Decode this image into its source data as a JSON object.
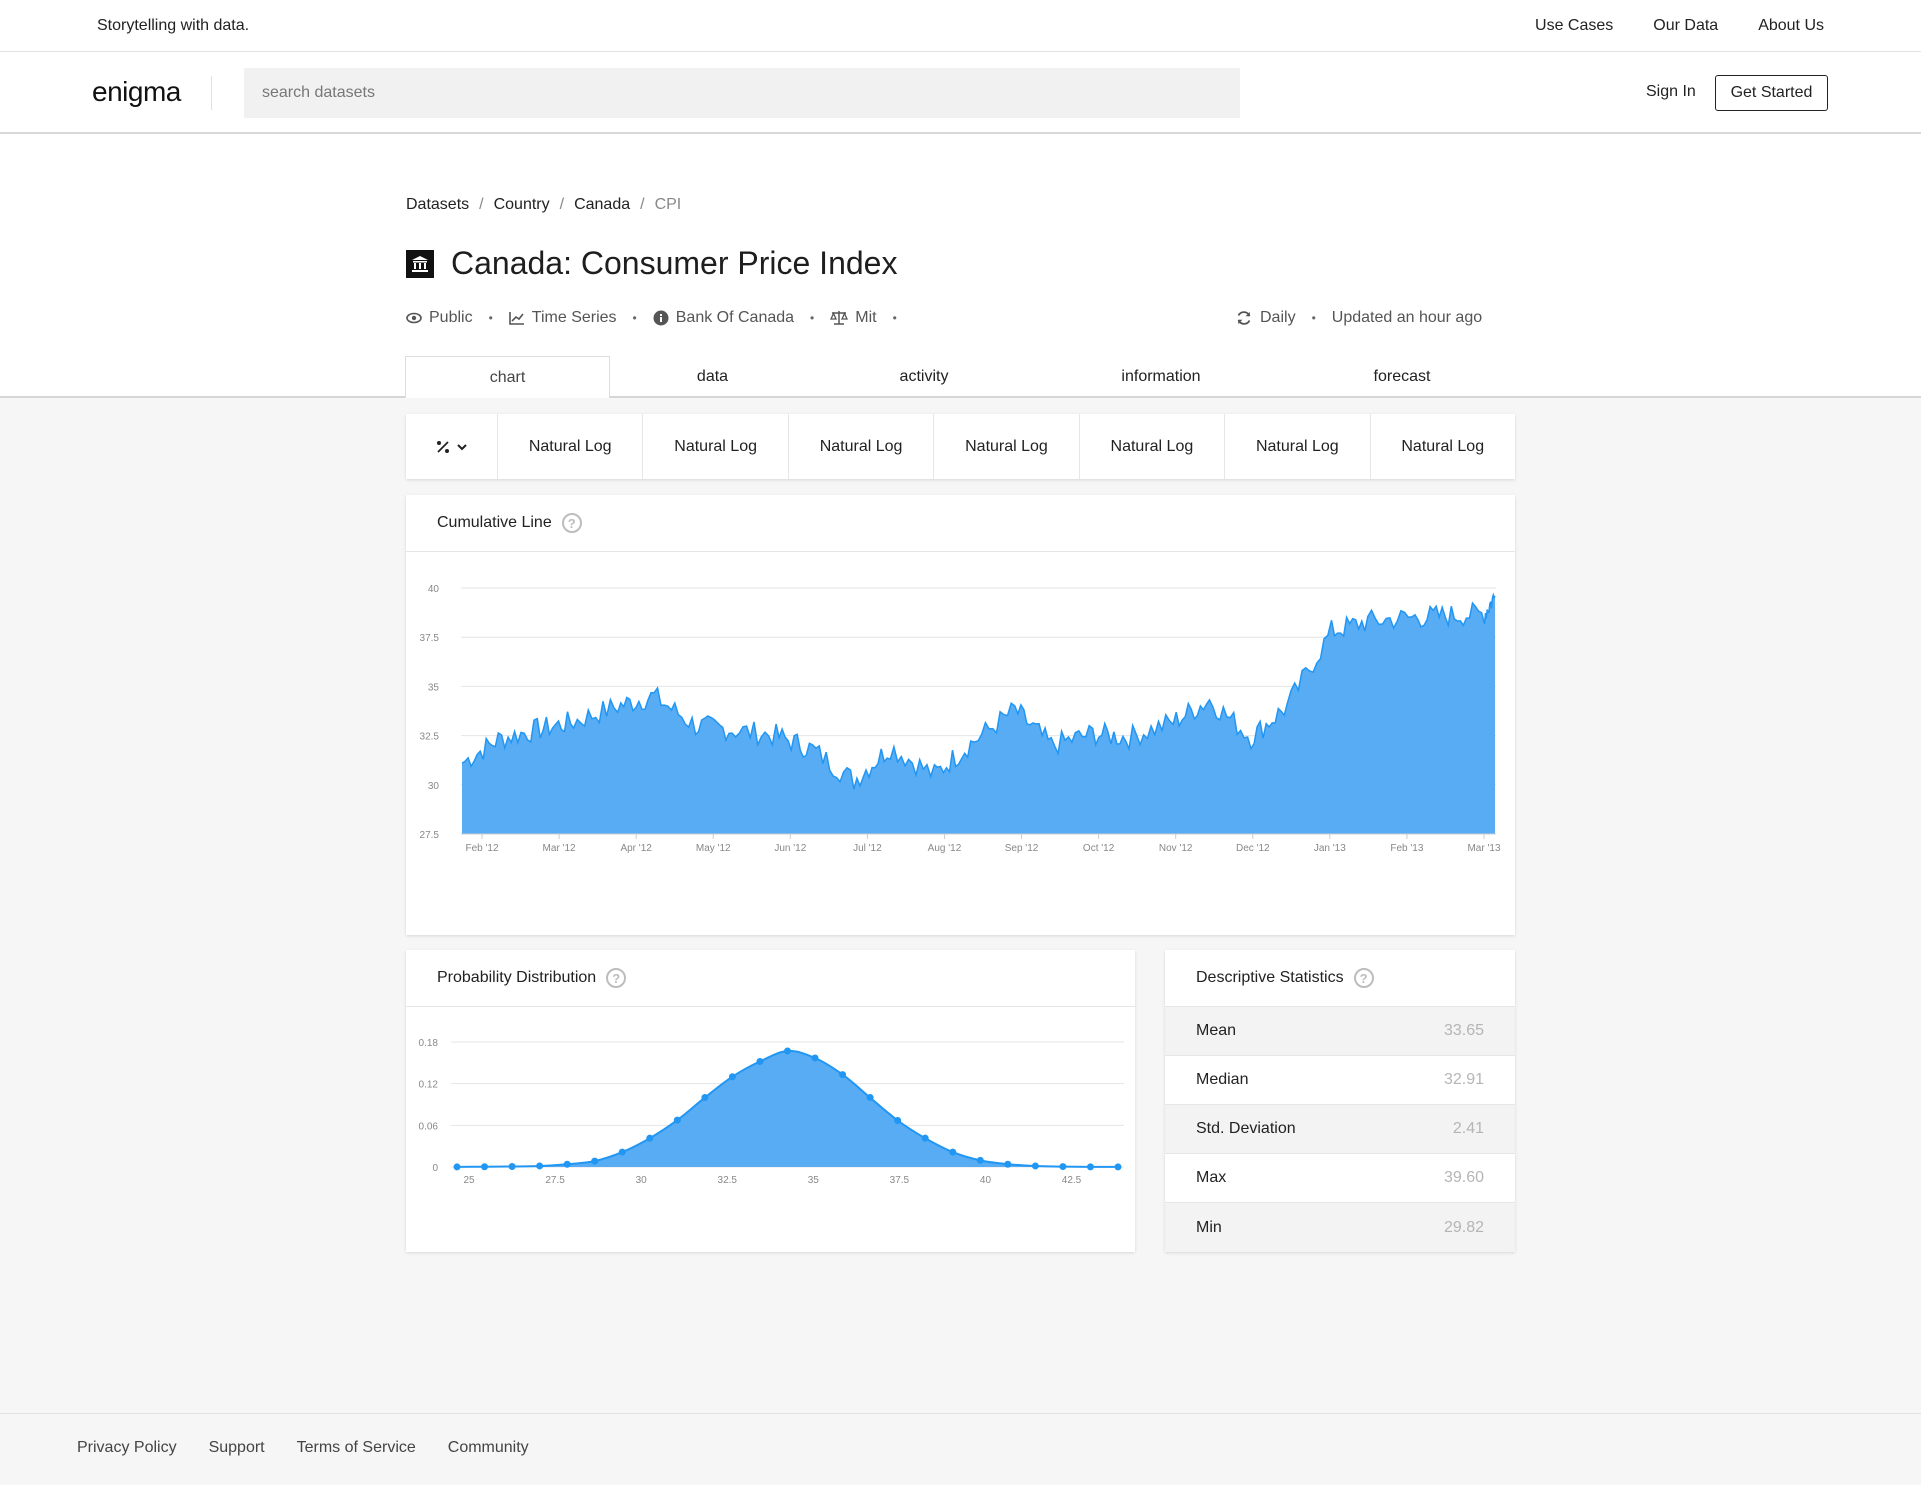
{
  "topbar": {
    "tagline": "Storytelling with data.",
    "nav": [
      "Use Cases",
      "Our Data",
      "About Us"
    ]
  },
  "header": {
    "logo": "enigma",
    "search_placeholder": "search datasets",
    "signin": "Sign In",
    "get_started": "Get Started"
  },
  "breadcrumb": {
    "items": [
      "Datasets",
      "Country",
      "Canada"
    ],
    "current": "CPI"
  },
  "page": {
    "title": "Canada: Consumer Price Index",
    "meta": {
      "visibility": "Public",
      "type": "Time Series",
      "source": "Bank Of Canada",
      "license": "Mit",
      "frequency": "Daily",
      "updated": "Updated an hour ago"
    }
  },
  "tabs": [
    "chart",
    "data",
    "activity",
    "information",
    "forecast"
  ],
  "toolbar": {
    "first_icon": "percent-icon",
    "buttons": [
      "Natural Log",
      "Natural Log",
      "Natural Log",
      "Natural Log",
      "Natural Log",
      "Natural Log",
      "Natural Log"
    ]
  },
  "cumulative": {
    "title": "Cumulative Line"
  },
  "distribution": {
    "title": "Probability Distribution"
  },
  "stats": {
    "title": "Descriptive Statistics",
    "rows": [
      {
        "label": "Mean",
        "value": "33.65"
      },
      {
        "label": "Median",
        "value": "32.91"
      },
      {
        "label": "Std. Deviation",
        "value": "2.41"
      },
      {
        "label": "Max",
        "value": "39.60"
      },
      {
        "label": "Min",
        "value": "29.82"
      }
    ]
  },
  "footer": {
    "links": [
      "Privacy Policy",
      "Support",
      "Terms of Service",
      "Community"
    ]
  },
  "colors": {
    "accent": "#2196f3",
    "area_fill": "#58acf4"
  },
  "chart_data": [
    {
      "type": "area",
      "ylim": [
        27.5,
        40
      ],
      "yticks": [
        "27.5",
        "30",
        "32.5",
        "35",
        "37.5",
        "40"
      ],
      "xtick_labels": [
        "Feb '12",
        "Mar '12",
        "Apr '12",
        "May '12",
        "Jun '12",
        "Jul '12",
        "Aug '12",
        "Sep '12",
        "Oct '12",
        "Nov '12",
        "Dec '12",
        "Jan '13",
        "Feb '13",
        "Mar '13"
      ],
      "x": [
        "2012-02-01",
        "2012-02-15",
        "2012-03-01",
        "2012-03-15",
        "2012-04-01",
        "2012-04-15",
        "2012-05-01",
        "2012-05-15",
        "2012-06-01",
        "2012-06-15",
        "2012-07-01",
        "2012-07-15",
        "2012-08-01",
        "2012-08-15",
        "2012-09-01",
        "2012-09-15",
        "2012-10-01",
        "2012-10-15",
        "2012-11-01",
        "2012-11-15",
        "2012-12-01",
        "2012-12-15",
        "2013-01-01",
        "2013-01-15",
        "2013-02-01",
        "2013-02-15",
        "2013-03-01",
        "2013-03-05"
      ],
      "y": [
        31.1,
        32.3,
        32.8,
        33.2,
        34.0,
        34.5,
        33.0,
        32.8,
        32.5,
        31.8,
        30.2,
        31.9,
        30.5,
        32.1,
        33.8,
        32.0,
        32.6,
        32.4,
        33.2,
        34.3,
        32.4,
        34.0,
        37.8,
        38.3,
        38.5,
        38.6,
        38.7,
        39.6
      ]
    },
    {
      "type": "area",
      "ylim": [
        0,
        0.18
      ],
      "yticks": [
        "0",
        "0.06",
        "0.12",
        "0.18"
      ],
      "xtick_labels": [
        "25",
        "27.5",
        "30",
        "32.5",
        "35",
        "37.5",
        "40",
        "42.5"
      ],
      "x": [
        24.65,
        25.45,
        26.25,
        27.05,
        27.85,
        28.65,
        29.45,
        30.25,
        31.05,
        31.85,
        32.65,
        33.45,
        34.25,
        35.05,
        35.85,
        36.65,
        37.45,
        38.25,
        39.05,
        39.85,
        40.65,
        41.45,
        42.25,
        43.05,
        43.85
      ],
      "y": [
        0.0001,
        0.0004,
        0.0007,
        0.0015,
        0.004,
        0.0085,
        0.0215,
        0.0415,
        0.0675,
        0.1,
        0.13,
        0.152,
        0.167,
        0.157,
        0.133,
        0.1,
        0.067,
        0.0415,
        0.0215,
        0.0095,
        0.004,
        0.0015,
        0.0006,
        0.0002,
        0.0001
      ]
    }
  ]
}
